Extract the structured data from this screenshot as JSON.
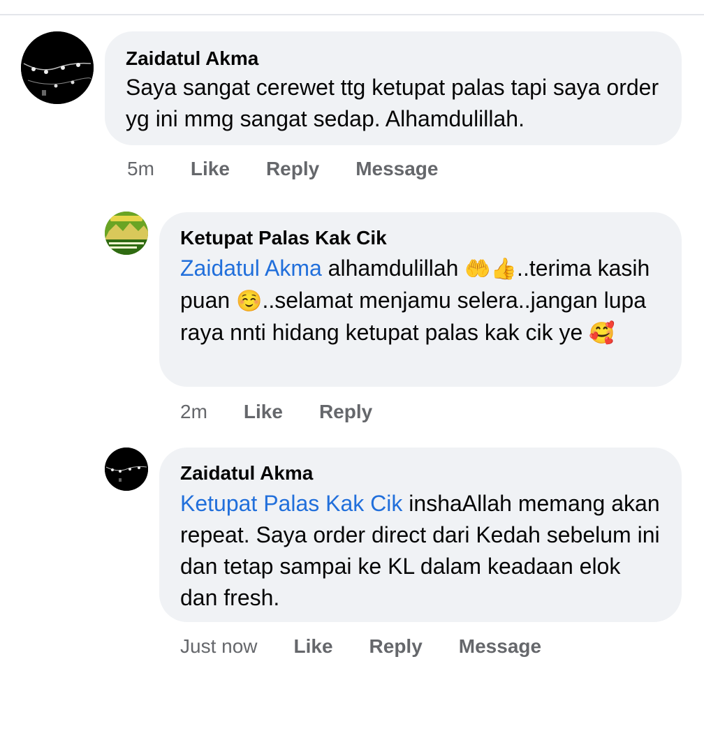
{
  "comments": [
    {
      "author": "Zaidatul Akma",
      "text": "Saya sangat cerewet ttg ketupat palas tapi saya order yg ini mmg sangat sedap. Alhamdulillah.",
      "time": "5m",
      "actions": [
        "Like",
        "Reply",
        "Message"
      ]
    },
    {
      "author": "Ketupat Palas Kak Cik",
      "mention": "Zaidatul Akma",
      "text_part1": " alhamdulillah ",
      "emoji1": "🤲👍",
      "text_part2": "..terima kasih puan ",
      "emoji2": "☺️",
      "text_part3": "..selamat menjamu selera..jangan lupa raya nnti hidang ketupat palas kak cik ye ",
      "emoji3": "🥰",
      "time": "2m",
      "actions": [
        "Like",
        "Reply"
      ]
    },
    {
      "author": "Zaidatul Akma",
      "mention": "Ketupat Palas Kak Cik",
      "text": " inshaAllah memang akan repeat. Saya order direct dari Kedah sebelum ini dan tetap sampai ke KL dalam keadaan elok dan fresh.",
      "time": "Just now",
      "actions": [
        "Like",
        "Reply",
        "Message"
      ]
    }
  ],
  "colors": {
    "bubble": "#f0f2f5",
    "mention": "#216fdb",
    "meta": "#65676b",
    "text": "#050505"
  },
  "icons": {
    "avatar_1": "string-lights-avatar",
    "avatar_2": "ketupat-palas-logo-avatar",
    "avatar_3": "string-lights-avatar"
  }
}
